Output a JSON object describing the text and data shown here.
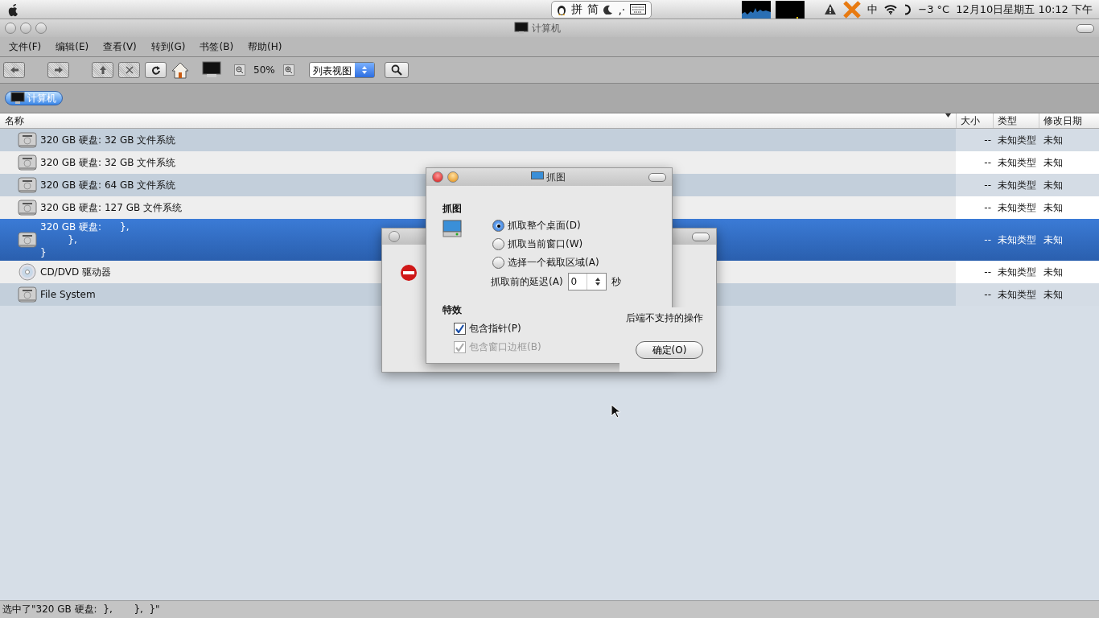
{
  "top_bar": {
    "input_method": {
      "items": [
        "拼",
        "简"
      ],
      "punct": ",·"
    },
    "temperature": "−3 °C",
    "clock": "12月10日星期五 10:12 下午",
    "ime_char": "中"
  },
  "window": {
    "title": "计算机"
  },
  "menu": [
    "文件(F)",
    "编辑(E)",
    "查看(V)",
    "转到(G)",
    "书签(B)",
    "帮助(H)"
  ],
  "toolbar": {
    "zoom": "50%",
    "view_mode": "列表视图"
  },
  "location": {
    "label": "计算机"
  },
  "columns": [
    "名称",
    "大小",
    "类型",
    "修改日期"
  ],
  "rows": [
    {
      "kind": "disk",
      "name": "320 GB 硬盘: 32 GB 文件系统",
      "size": "--",
      "type": "未知类型",
      "modified": "未知",
      "selected": false
    },
    {
      "kind": "disk",
      "name": "320 GB 硬盘: 32 GB 文件系统",
      "size": "--",
      "type": "未知类型",
      "modified": "未知",
      "selected": false
    },
    {
      "kind": "disk",
      "name": "320 GB 硬盘: 64 GB 文件系统",
      "size": "--",
      "type": "未知类型",
      "modified": "未知",
      "selected": false
    },
    {
      "kind": "disk",
      "name": "320 GB 硬盘: 127 GB 文件系统",
      "size": "--",
      "type": "未知类型",
      "modified": "未知",
      "selected": false
    },
    {
      "kind": "disk",
      "name": "320 GB 硬盘:      },\n         },\n}",
      "size": "--",
      "type": "未知类型",
      "modified": "未知",
      "selected": true
    },
    {
      "kind": "cd",
      "name": "CD/DVD 驱动器",
      "size": "--",
      "type": "未知类型",
      "modified": "未知",
      "selected": false
    },
    {
      "kind": "disk",
      "name": "File System",
      "size": "--",
      "type": "未知类型",
      "modified": "未知",
      "selected": false
    }
  ],
  "status_bar": "选中了\"320 GB 硬盘:  },       },  }\"",
  "error_dialog": {
    "message": "后端不支持的操作",
    "button": "确定(O)"
  },
  "screenshot_dialog": {
    "title": "抓图",
    "grab_heading": "抓图",
    "options": [
      {
        "label": "抓取整个桌面(D)",
        "selected": true
      },
      {
        "label": "抓取当前窗口(W)",
        "selected": false
      },
      {
        "label": "选择一个截取区域(A)",
        "selected": false
      }
    ],
    "delay_label": "抓取前的延迟(A)",
    "delay_value": "0",
    "delay_unit": "秒",
    "effects_heading": "特效",
    "effects": [
      {
        "label": "包含指针(P)",
        "checked": true,
        "disabled": false
      },
      {
        "label": "包含窗口边框(B)",
        "checked": true,
        "disabled": true
      }
    ]
  }
}
